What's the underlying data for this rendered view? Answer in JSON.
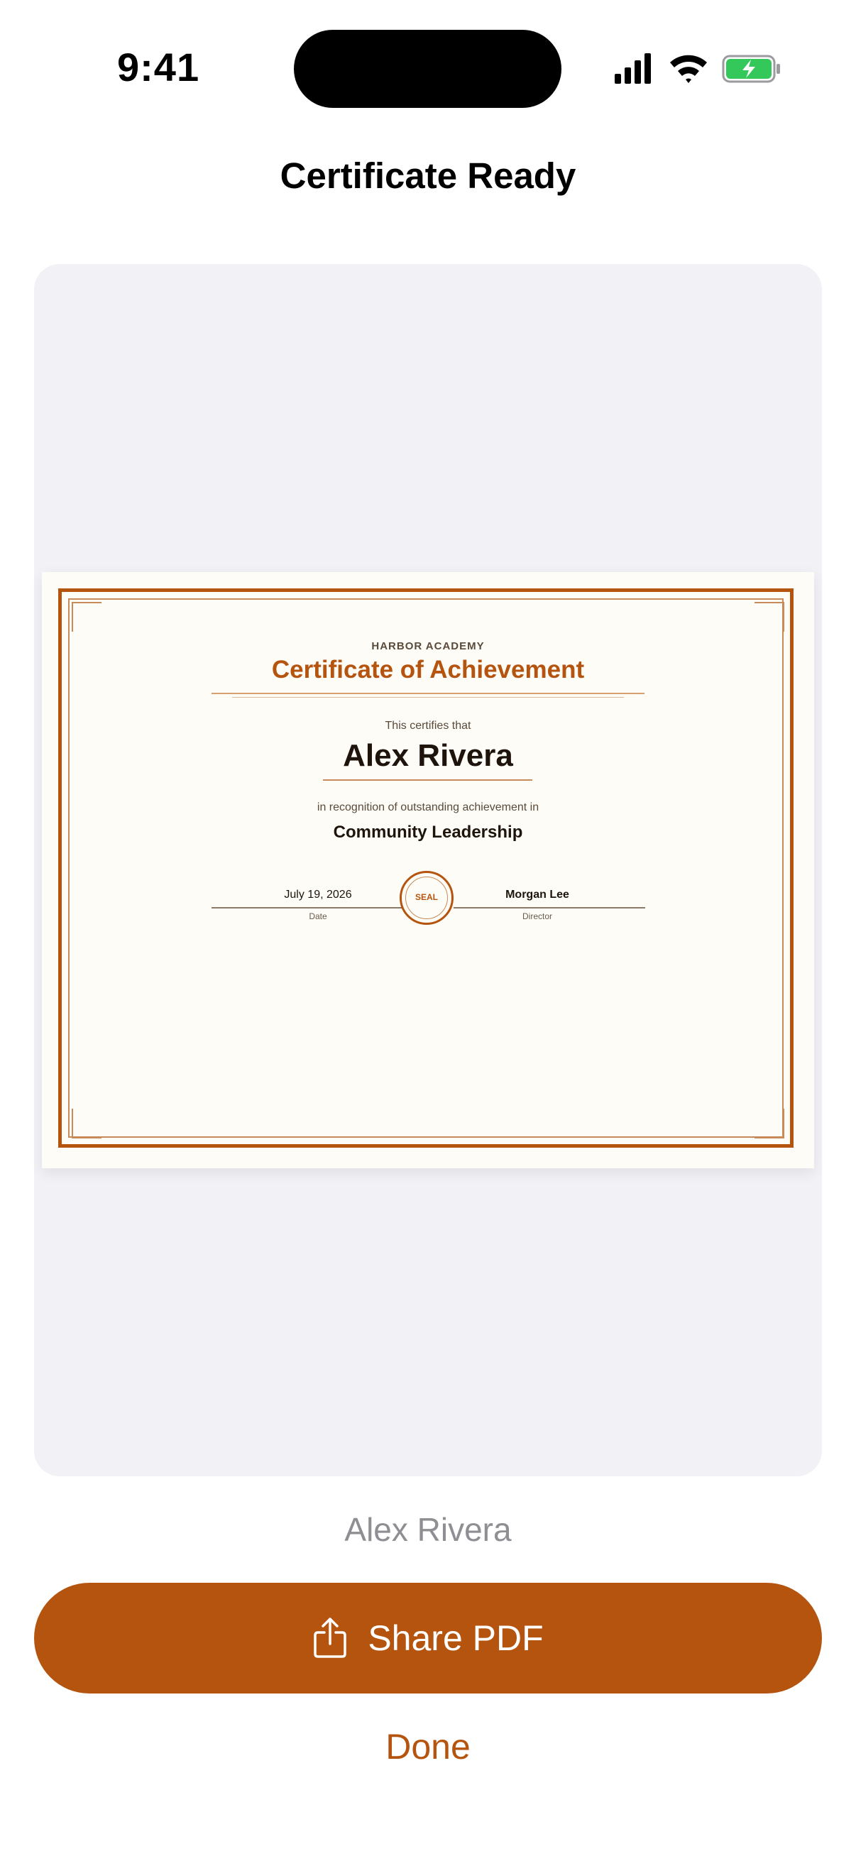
{
  "status_bar": {
    "time": "9:41"
  },
  "header": {
    "title": "Certificate Ready"
  },
  "certificate": {
    "organization": "HARBOR ACADEMY",
    "heading": "Certificate of Achievement",
    "certifies_text": "This certifies that",
    "recipient_name": "Alex Rivera",
    "recognition_text": "in recognition of outstanding achievement in",
    "field": "Community Leadership",
    "date": "July 19, 2026",
    "date_label": "Date",
    "seal_text": "SEAL",
    "signer": "Morgan Lee",
    "signer_label": "Director"
  },
  "caption": {
    "recipient": "Alex Rivera"
  },
  "actions": {
    "share_label": "Share PDF",
    "done_label": "Done"
  },
  "icons": {
    "share": "share-icon",
    "signal": "cellular-signal-icon",
    "wifi": "wifi-icon",
    "battery": "battery-charging-icon"
  },
  "colors": {
    "accent": "#b5540f",
    "panel_bg": "#f1f1f6",
    "caption_gray": "#8e8e93",
    "battery_green": "#34c759"
  }
}
